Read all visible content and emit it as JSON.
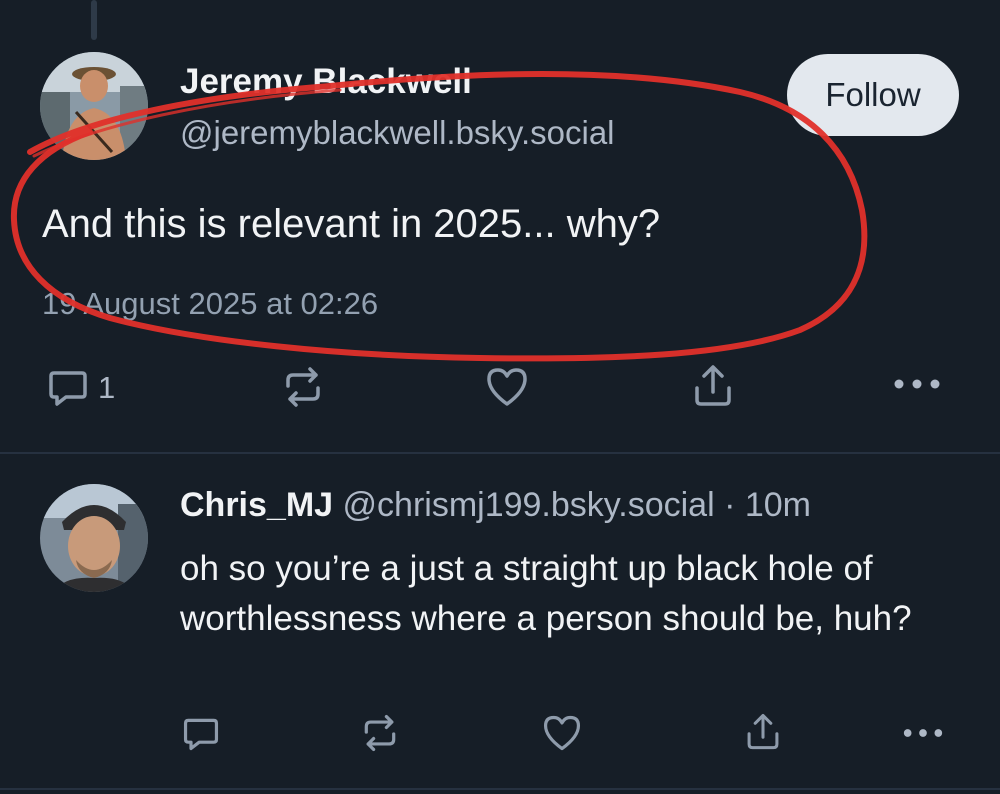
{
  "post": {
    "author_name": "Jeremy Blackwell",
    "author_handle": "@jeremyblackwell.bsky.social",
    "follow_label": "Follow",
    "text": "And this is relevant in 2025... why?",
    "timestamp": "19 August 2025 at 02:26",
    "reply_count": "1",
    "icons": [
      "reply-icon",
      "repost-icon",
      "like-icon",
      "share-icon",
      "more-icon"
    ]
  },
  "reply": {
    "author_name": "Chris_MJ",
    "author_handle": "@chrismj199.bsky.social",
    "separator": "·",
    "time_ago": "10m",
    "text": "oh so you’re a just a straight up black hole of worthlessness where a person should be, huh?",
    "icons": [
      "reply-icon",
      "repost-icon",
      "like-icon",
      "share-icon",
      "more-icon"
    ]
  },
  "colors": {
    "background": "#161e27",
    "annotation": "#e0302a",
    "follow_button": "#e3e8ee"
  }
}
